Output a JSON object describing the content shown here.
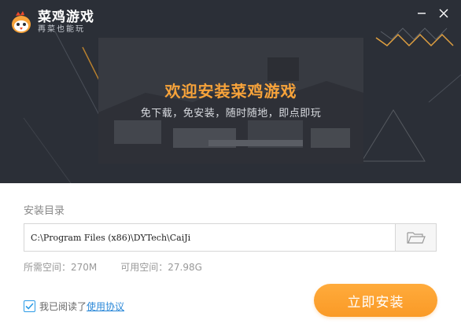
{
  "app": {
    "title": "菜鸡游戏",
    "subtitle": "再菜也能玩"
  },
  "window_controls": {
    "minimize_icon": "minimize-icon",
    "close_icon": "close-icon"
  },
  "banner": {
    "title": "欢迎安装菜鸡游戏",
    "subtitle": "免下载，免安装，随时随地，即点即玩"
  },
  "install": {
    "dir_label": "安装目录",
    "path_value": "C:\\Program Files (x86)\\DYTech\\CaiJi",
    "browse_icon": "folder-icon",
    "required_space": "所需空间：270M",
    "available_space": "可用空间：27.98G",
    "agree_text": "我已阅读了",
    "agree_link": "使用协议",
    "agree_checked": true,
    "button_label": "立即安装"
  },
  "colors": {
    "header_bg": "#2b2f37",
    "accent": "#f7a33a",
    "button": "#fa9a26",
    "link": "#2b88d8",
    "checkbox": "#2b9be6"
  }
}
